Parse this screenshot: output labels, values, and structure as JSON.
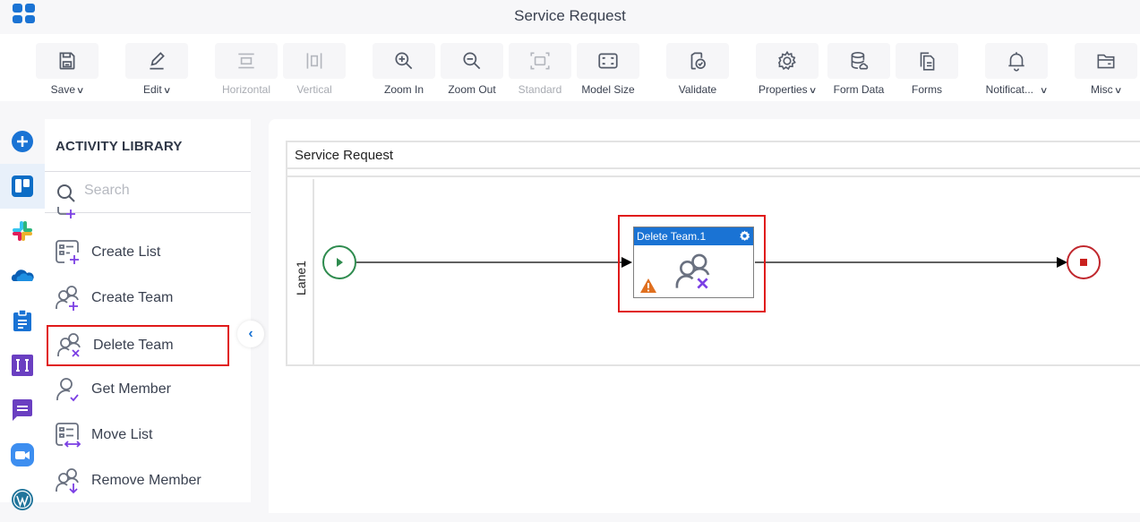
{
  "header": {
    "title": "Service Request",
    "app_icon": "app-grid-icon"
  },
  "toolbar": {
    "items": [
      {
        "id": "save",
        "label": "Save",
        "icon": "save-icon",
        "dropdown": true,
        "disabled": false
      },
      {
        "id": "edit",
        "label": "Edit",
        "icon": "edit-icon",
        "dropdown": true,
        "disabled": false
      },
      {
        "id": "horizontal",
        "label": "Horizontal",
        "icon": "horizontal-align-icon",
        "dropdown": false,
        "disabled": true
      },
      {
        "id": "vertical",
        "label": "Vertical",
        "icon": "vertical-align-icon",
        "dropdown": false,
        "disabled": true
      },
      {
        "id": "zoom-in",
        "label": "Zoom In",
        "icon": "zoom-in-icon",
        "dropdown": false,
        "disabled": false
      },
      {
        "id": "zoom-out",
        "label": "Zoom Out",
        "icon": "zoom-out-icon",
        "dropdown": false,
        "disabled": false
      },
      {
        "id": "standard",
        "label": "Standard",
        "icon": "standard-size-icon",
        "dropdown": false,
        "disabled": true
      },
      {
        "id": "model-size",
        "label": "Model Size",
        "icon": "model-size-icon",
        "dropdown": false,
        "disabled": false
      },
      {
        "id": "validate",
        "label": "Validate",
        "icon": "validate-icon",
        "dropdown": false,
        "disabled": false
      },
      {
        "id": "properties",
        "label": "Properties",
        "icon": "gear-icon",
        "dropdown": true,
        "disabled": false
      },
      {
        "id": "form-data",
        "label": "Form Data",
        "icon": "database-icon",
        "dropdown": false,
        "disabled": false
      },
      {
        "id": "forms",
        "label": "Forms",
        "icon": "forms-icon",
        "dropdown": false,
        "disabled": false
      },
      {
        "id": "notifications",
        "label": "Notificat...",
        "icon": "bell-icon",
        "dropdown": true,
        "disabled": false
      },
      {
        "id": "misc",
        "label": "Misc",
        "icon": "folder-icon",
        "dropdown": true,
        "disabled": false
      }
    ]
  },
  "left_rail": {
    "items": [
      {
        "name": "add",
        "icon": "plus-circle-icon"
      },
      {
        "name": "trello",
        "icon": "trello-icon",
        "active": true
      },
      {
        "name": "slack",
        "icon": "slack-icon"
      },
      {
        "name": "onedrive",
        "icon": "onedrive-icon"
      },
      {
        "name": "clipboard",
        "icon": "clipboard-icon"
      },
      {
        "name": "text-app",
        "icon": "text-app-icon"
      },
      {
        "name": "chat",
        "icon": "chat-icon"
      },
      {
        "name": "zoom",
        "icon": "zoom-video-icon"
      },
      {
        "name": "wordpress",
        "icon": "wordpress-icon"
      }
    ]
  },
  "activity_library": {
    "title": "ACTIVITY LIBRARY",
    "search_placeholder": "Search",
    "search_value": "",
    "items": [
      {
        "label": "Create List",
        "icon": "create-list-icon"
      },
      {
        "label": "Create Team",
        "icon": "create-team-icon"
      },
      {
        "label": "Delete Team",
        "icon": "delete-team-icon",
        "selected": true
      },
      {
        "label": "Get Member",
        "icon": "get-member-icon"
      },
      {
        "label": "Move List",
        "icon": "move-list-icon"
      },
      {
        "label": "Remove Member",
        "icon": "remove-member-icon"
      }
    ],
    "collapse_icon": "chevron-left-icon"
  },
  "canvas": {
    "pool_title": "Service Request",
    "lane_label": "Lane1",
    "task": {
      "title": "Delete Team.1",
      "icon": "delete-team-icon",
      "warning": true
    },
    "colors": {
      "start": "#2e8b4e",
      "end": "#c0272d",
      "task_header": "#1a73d4",
      "selection": "#e01a1a",
      "warning": "#e07020"
    }
  }
}
